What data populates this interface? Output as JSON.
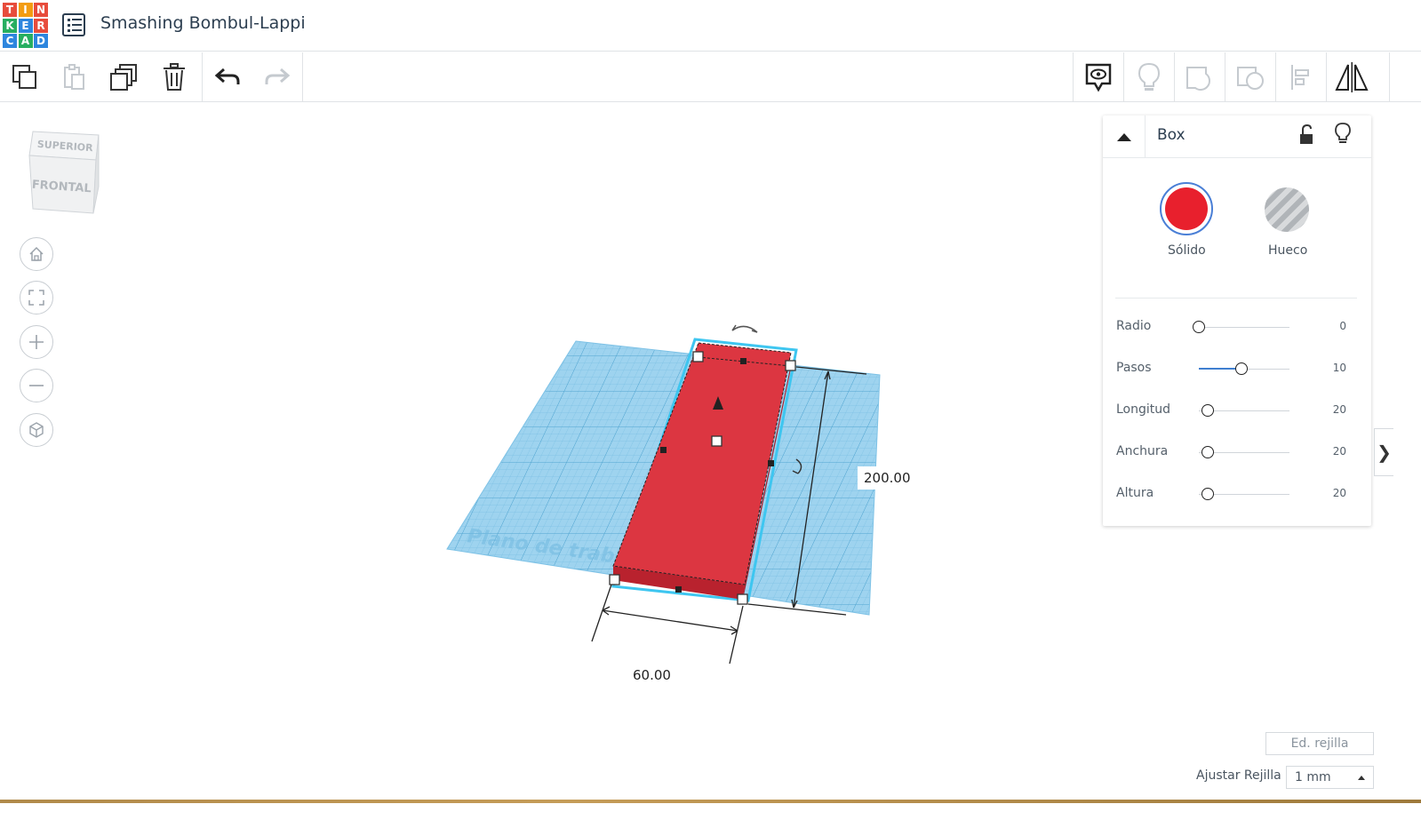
{
  "header": {
    "logo_letters": [
      "T",
      "I",
      "N",
      "K",
      "E",
      "R",
      "C",
      "A",
      "D"
    ],
    "logo_colors": [
      "#e74c3c",
      "#f39c12",
      "#e74c3c",
      "#27ae60",
      "#2e86de",
      "#e74c3c",
      "#2e86de",
      "#27ae60",
      "#2e86de"
    ],
    "project_title": "Smashing Bombul-Lappi"
  },
  "toolbar": {
    "left_buttons": [
      "copy-icon",
      "paste-icon",
      "duplicate-icon",
      "delete-icon",
      "undo-icon",
      "redo-icon"
    ],
    "right_buttons": [
      "note-icon",
      "lightbulb-icon",
      "group-icon",
      "ungroup-icon",
      "align-icon",
      "mirror-icon"
    ]
  },
  "viewcube": {
    "top_label": "SUPERIOR",
    "front_label": "FRONTAL"
  },
  "nav": {
    "buttons": [
      "home-view-icon",
      "fit-view-icon",
      "zoom-in-icon",
      "zoom-out-icon",
      "perspective-icon"
    ]
  },
  "workplane": {
    "watermark": "Plano de trabajo",
    "width_dimension": "60.00",
    "length_dimension": "200.00"
  },
  "inspector": {
    "title": "Box",
    "solid_label": "Sólido",
    "hole_label": "Hueco",
    "solid_color": "#e8202d",
    "params": [
      {
        "label": "Radio",
        "value": "0",
        "fraction": 0.0
      },
      {
        "label": "Pasos",
        "value": "10",
        "fraction": 0.47
      },
      {
        "label": "Longitud",
        "value": "20",
        "fraction": 0.1
      },
      {
        "label": "Anchura",
        "value": "20",
        "fraction": 0.1
      },
      {
        "label": "Altura",
        "value": "20",
        "fraction": 0.1
      }
    ]
  },
  "grid": {
    "edit_label": "Ed. rejilla",
    "snap_label": "Ajustar Rejilla",
    "snap_value": "1 mm"
  }
}
